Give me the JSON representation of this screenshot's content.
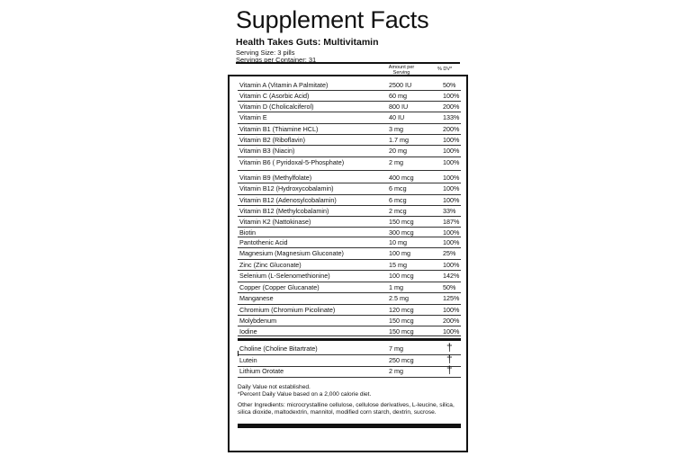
{
  "header": {
    "title": "Supplement Facts",
    "product": "Health Takes Guts: Multivitamin",
    "serving_size": "Serving Size:  3 pills",
    "servings_per_container": "Servings per Container: 31",
    "col_amount": "Amount per Serving",
    "col_dv": "% DV*"
  },
  "nutrients": [
    {
      "name": "Vitamin A (Vitamin A Palmitate)",
      "amount": "2500 IU",
      "dv": "50%"
    },
    {
      "name": "Vitamin C (Asorbic Acid)",
      "amount": "60 mg",
      "dv": "100%"
    },
    {
      "name": "Vitamin D (Cholicalciferol)",
      "amount": "800 IU",
      "dv": "200%"
    },
    {
      "name": "Vitamin E",
      "amount": "40 IU",
      "dv": "133%"
    },
    {
      "name": "Vitamin B1 (Thiamine HCL)",
      "amount": "3 mg",
      "dv": "200%"
    },
    {
      "name": "Vitamin B2 (Riboflavin)",
      "amount": "1.7 mg",
      "dv": "100%"
    },
    {
      "name": "Vitamin B3 (Niacin)",
      "amount": "20 mg",
      "dv": "100%"
    },
    {
      "name": "Vitamin B6 ( Pyridoxal-5-Phosphate)",
      "amount": "2 mg",
      "dv": "100%"
    },
    {
      "name": "Vitamin B9 (Methylfolate)",
      "amount": "400 mcg",
      "dv": "100%"
    },
    {
      "name": "Vitamin B12 (Hydroxycobalamin)",
      "amount": "6 mcg",
      "dv": "100%"
    },
    {
      "name": "Vitamin B12 (Adenosylcobalamin)",
      "amount": "6 mcg",
      "dv": "100%"
    },
    {
      "name": "Vitamin B12 (Methylcobalamin)",
      "amount": "2 mcg",
      "dv": "33%"
    },
    {
      "name": "Vitamin K2  (Nattokinase)",
      "amount": "150 mcg",
      "dv": "187%"
    },
    {
      "name": "Biotin",
      "amount": "300 mcg",
      "dv": "100%"
    },
    {
      "name": "Pantothenic Acid",
      "amount": "10 mg",
      "dv": "100%"
    },
    {
      "name": "Magnesium (Magnesium Gluconate)",
      "amount": "100 mg",
      "dv": "25%"
    },
    {
      "name": "Zinc (Zinc Gluconate)",
      "amount": "15 mg",
      "dv": "100%"
    },
    {
      "name": "Selenium (L-Selenomethionine)",
      "amount": "100 mcg",
      "dv": "142%"
    },
    {
      "name": "Copper (Copper Glucanate)",
      "amount": "1 mg",
      "dv": "50%"
    },
    {
      "name": "Manganese",
      "amount": "2.5 mg",
      "dv": "125%"
    },
    {
      "name": "Chromium (Chromium Picolinate)",
      "amount": "120 mcg",
      "dv": "100%"
    },
    {
      "name": "Molybdenum",
      "amount": "150 mcg",
      "dv": "200%"
    },
    {
      "name": "Iodine",
      "amount": "150 mcg",
      "dv": "100%"
    }
  ],
  "others": [
    {
      "name": "Choline (Choline Bitartrate)",
      "amount": "7 mg",
      "dv": "†"
    },
    {
      "name": "Lutein",
      "amount": "250 mcg",
      "dv": "†"
    },
    {
      "name": "Lithium Orotate",
      "amount": "2 mg",
      "dv": "†"
    }
  ],
  "footnotes": {
    "dagger_note": "Daily Value not established.",
    "percent_note": "*Percent Daily Value based on a 2,000 calorie diet.",
    "ingredients": "Other Ingredients: microcrystalline cellulose, cellulose derivatives, L-leucine, silica, silica dioxide, maltodextrin, mannitol, modified corn starch, dextrin, sucrose."
  }
}
